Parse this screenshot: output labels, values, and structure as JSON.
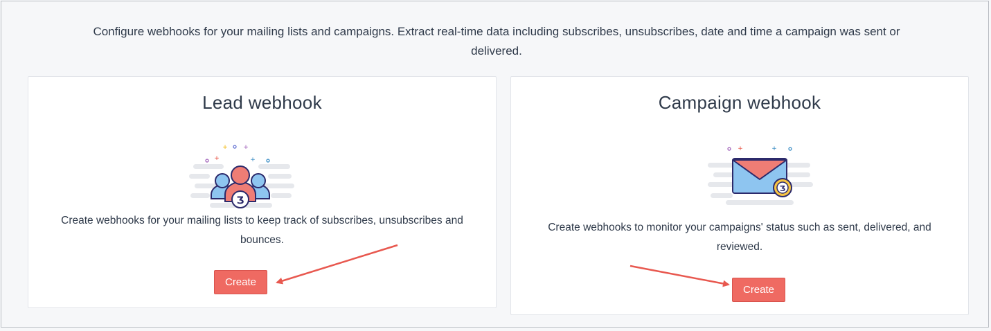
{
  "intro_text": "Configure webhooks for your mailing lists and campaigns. Extract real-time data including subscribes, unsubscribes, date and time a campaign was sent or delivered.",
  "cards": [
    {
      "title": "Lead webhook",
      "description": "Create webhooks for your mailing lists to keep track of subscribes, unsubscribes and bounces.",
      "button_label": "Create",
      "illustration_icon": "people-group-icon"
    },
    {
      "title": "Campaign webhook",
      "description": "Create webhooks to monitor your campaigns' status such as sent, delivered, and reviewed.",
      "button_label": "Create",
      "illustration_icon": "envelope-icon"
    }
  ],
  "colors": {
    "accent": "#ef6a62",
    "background": "#f6f7f9",
    "card": "#ffffff",
    "text": "#2f3a4a",
    "arrow": "#e8584f"
  }
}
